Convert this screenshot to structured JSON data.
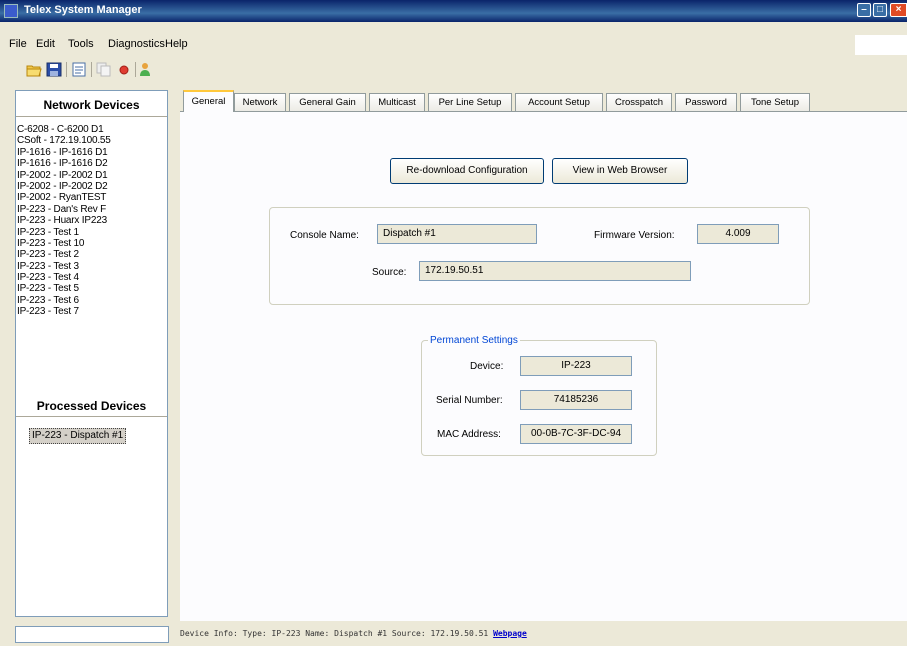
{
  "window": {
    "title": "Telex System Manager"
  },
  "menu": [
    "File",
    "Edit",
    "Tools",
    "Diagnostics",
    "Help"
  ],
  "sidebar": {
    "network_title": "Network Devices",
    "network_devices": [
      "C-6208 - C-6200 D1",
      "CSoft - 172.19.100.55",
      "IP-1616 - IP-1616 D1",
      "IP-1616 - IP-1616 D2",
      "IP-2002 - IP-2002 D1",
      "IP-2002 - IP-2002 D2",
      "IP-2002 - RyanTEST",
      "IP-223 - Dan's Rev F",
      "IP-223 - Huarx IP223",
      "IP-223 - Test 1",
      "IP-223 - Test 10",
      "IP-223 - Test 2",
      "IP-223 - Test 3",
      "IP-223 - Test 4",
      "IP-223 - Test 5",
      "IP-223 - Test 6",
      "IP-223 - Test 7"
    ],
    "processed_title": "Processed Devices",
    "processed_devices": [
      "IP-223 - Dispatch #1"
    ]
  },
  "tabs": [
    "General",
    "Network",
    "General Gain",
    "Multicast",
    "Per Line Setup",
    "Account Setup",
    "Crosspatch",
    "Password",
    "Tone Setup"
  ],
  "general": {
    "redownload_button": "Re-download Configuration",
    "web_button": "View in Web Browser",
    "console_name_label": "Console Name:",
    "console_name_value": "Dispatch #1",
    "firmware_label": "Firmware Version:",
    "firmware_value": "4.009",
    "source_label": "Source:",
    "source_value": "172.19.50.51",
    "permanent_legend": "Permanent Settings",
    "device_label": "Device:",
    "device_value": "IP-223",
    "serial_label": "Serial Number:",
    "serial_value": "74185236",
    "mac_label": "MAC Address:",
    "mac_value": "00-0B-7C-3F-DC-94"
  },
  "status": {
    "text": "Device Info:  Type: IP-223  Name: Dispatch #1  Source: 172.19.50.51 ",
    "link": "Webpage"
  }
}
